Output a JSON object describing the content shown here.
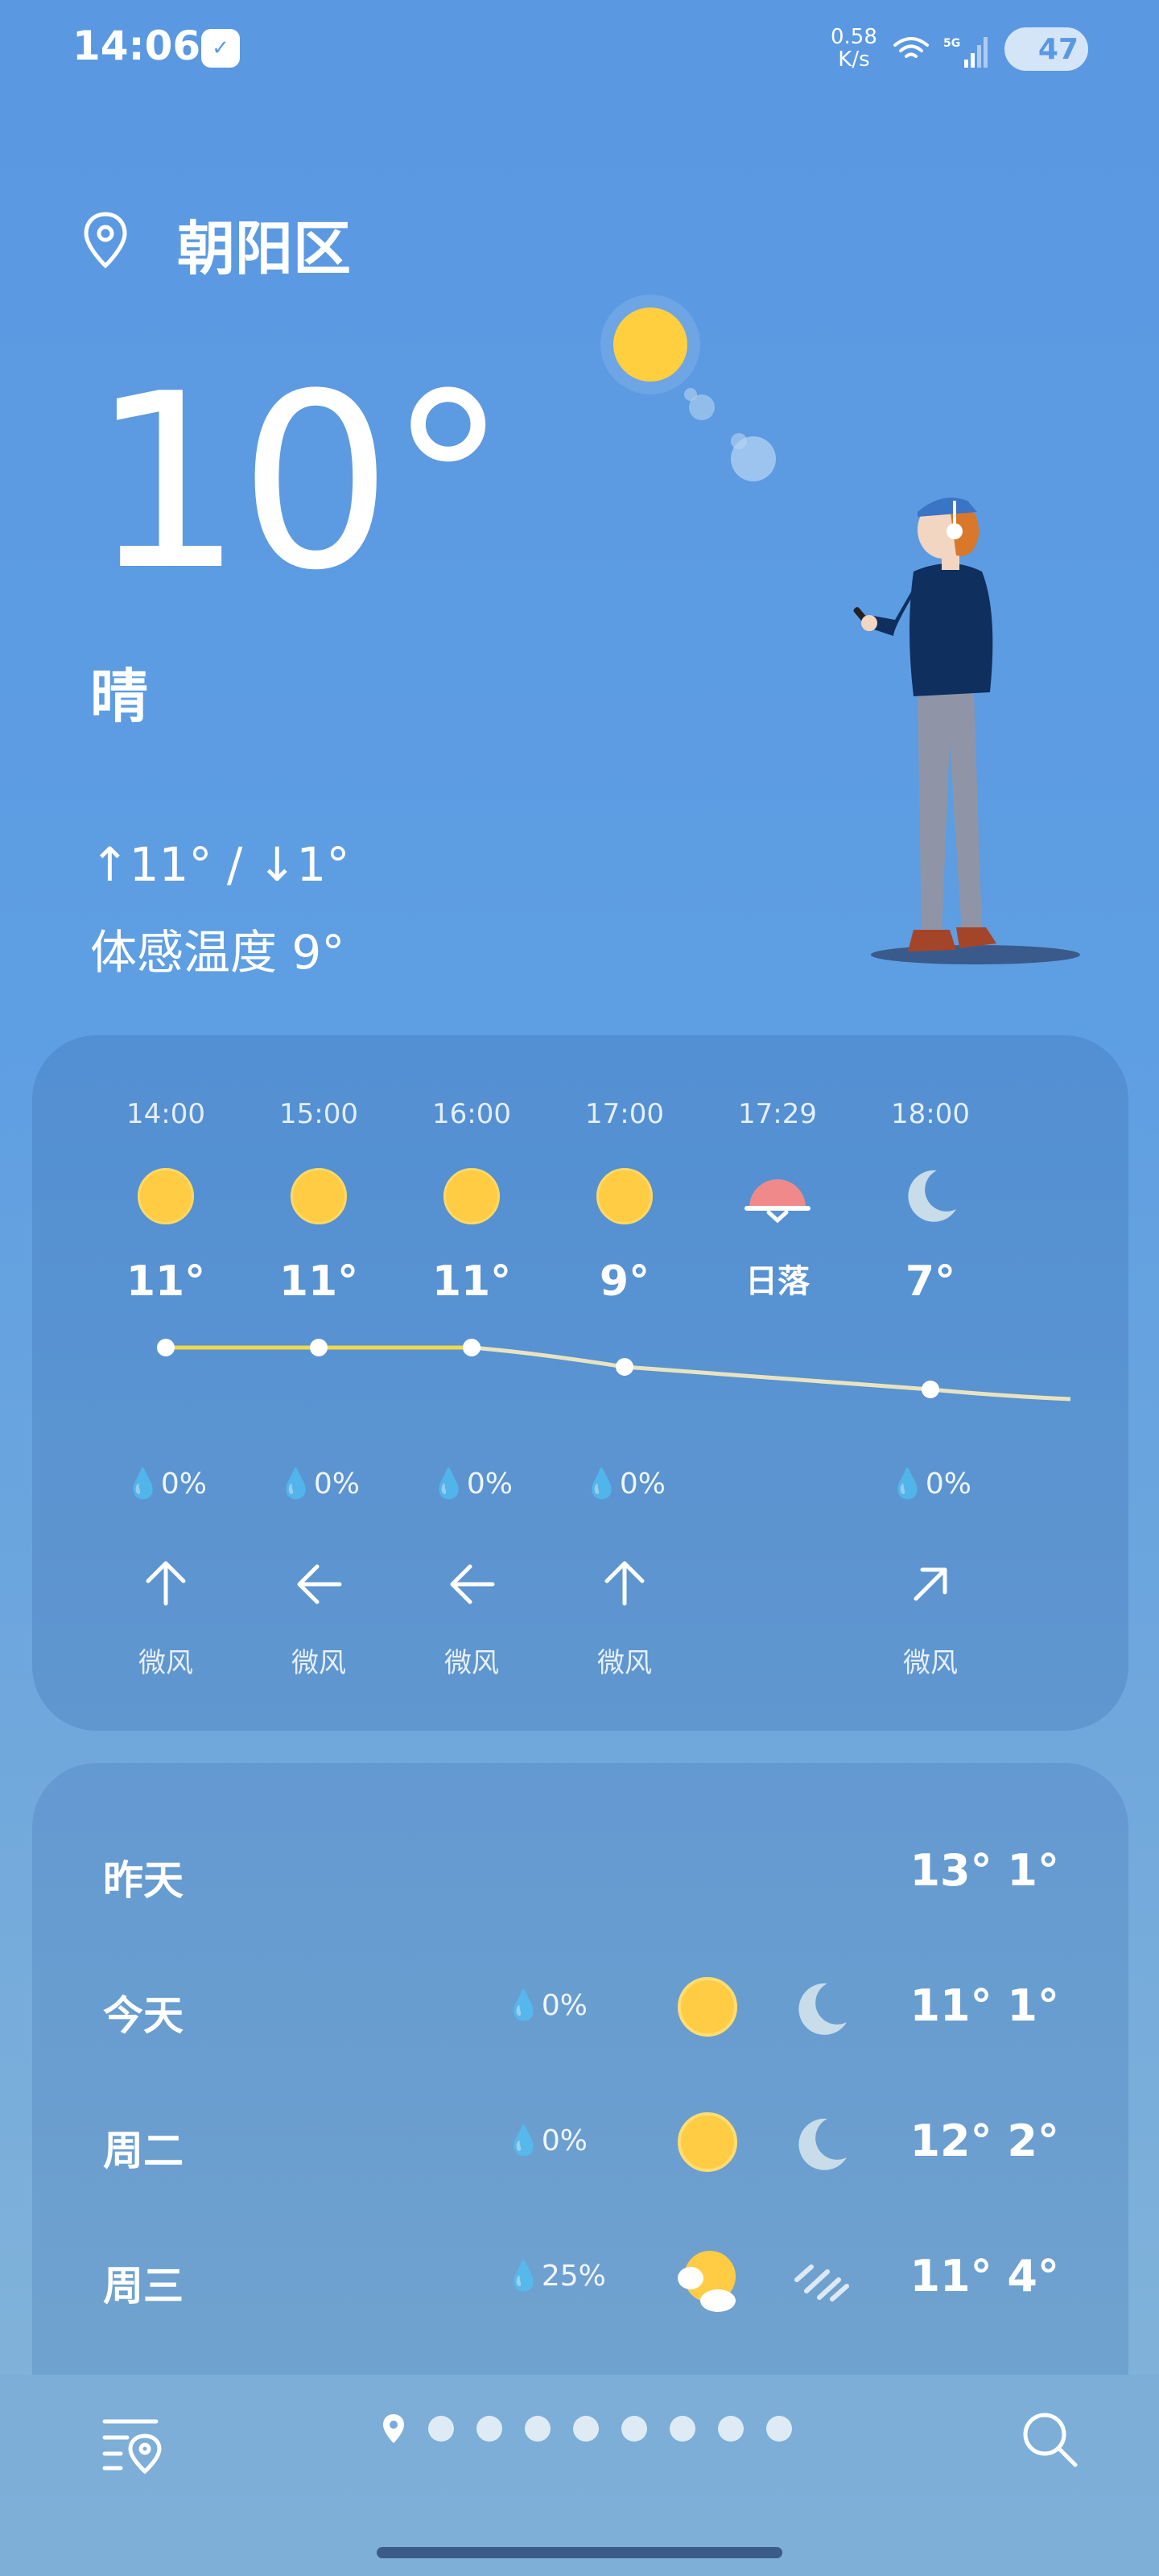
{
  "status_bar": {
    "time": "14:06",
    "net_speed_value": "0.58",
    "net_speed_unit": "K/s",
    "signal": "5G",
    "battery": "47"
  },
  "location": {
    "name": "朝阳区"
  },
  "current": {
    "temperature": "10°",
    "condition": "晴",
    "high_low": "↑11° / ↓1°",
    "feels_like": "体感温度 9°"
  },
  "hourly": [
    {
      "time": "14:00",
      "icon": "sun-icon",
      "temp": "11°",
      "rain": "0%",
      "wind_dir": "north",
      "wind": "微风"
    },
    {
      "time": "15:00",
      "icon": "sun-icon",
      "temp": "11°",
      "rain": "0%",
      "wind_dir": "west",
      "wind": "微风"
    },
    {
      "time": "16:00",
      "icon": "sun-icon",
      "temp": "11°",
      "rain": "0%",
      "wind_dir": "west",
      "wind": "微风"
    },
    {
      "time": "17:00",
      "icon": "sun-icon",
      "temp": "9°",
      "rain": "0%",
      "wind_dir": "north",
      "wind": "微风"
    },
    {
      "time": "17:29",
      "icon": "sunset-icon",
      "temp": "日落",
      "rain": "",
      "wind_dir": "",
      "wind": ""
    },
    {
      "time": "18:00",
      "icon": "moon-icon",
      "temp": "7°",
      "rain": "0%",
      "wind_dir": "northeast",
      "wind": "微风"
    }
  ],
  "daily": [
    {
      "day": "昨天",
      "rain": "",
      "day_icon": "",
      "night_icon": "",
      "hi": "13°",
      "lo": "1°"
    },
    {
      "day": "今天",
      "rain": "0%",
      "day_icon": "sun-icon",
      "night_icon": "moon-icon",
      "hi": "11°",
      "lo": "1°"
    },
    {
      "day": "周二",
      "rain": "0%",
      "day_icon": "sun-icon",
      "night_icon": "moon-icon",
      "hi": "12°",
      "lo": "2°"
    },
    {
      "day": "周三",
      "rain": "25%",
      "day_icon": "partly-cloudy-icon",
      "night_icon": "wind-icon",
      "hi": "11°",
      "lo": "4°"
    }
  ],
  "pager": {
    "count": 9,
    "current": 0
  },
  "colors": {
    "background_top": "#5a98e2",
    "sun": "#ffcc44",
    "sunset": "#f08a8a",
    "moon": "#c8dcea",
    "temp_line_day": "#f0d84a",
    "temp_line_night": "#e8e4c0"
  }
}
